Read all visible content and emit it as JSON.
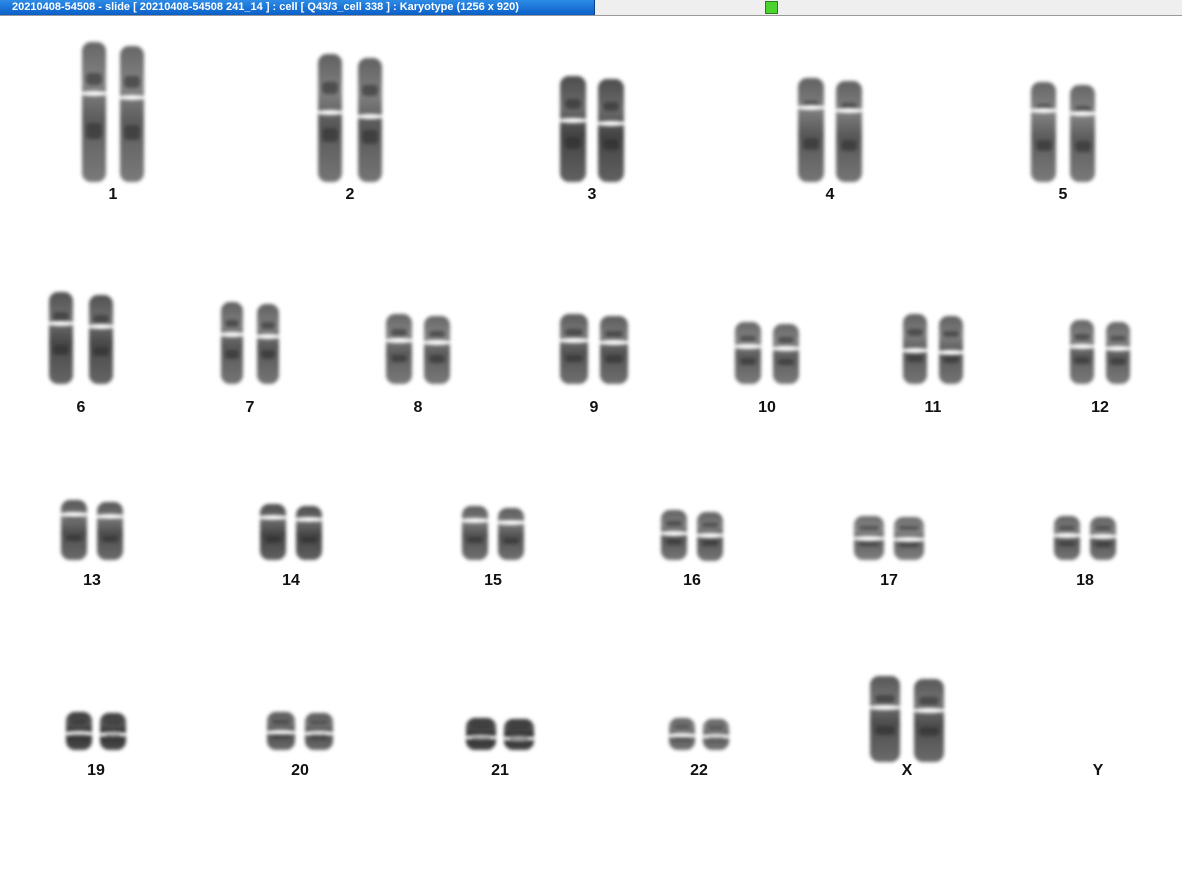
{
  "window": {
    "title": "20210408-54508 - slide [ 20210408-54508 241_14 ] : cell [ Q43/3_cell 338 ] : Karyotype  (1256 x 920)",
    "status_color": "#4cd42e"
  },
  "karyotype": {
    "chromosomes": [
      {
        "label": "1"
      },
      {
        "label": "2"
      },
      {
        "label": "3"
      },
      {
        "label": "4"
      },
      {
        "label": "5"
      },
      {
        "label": "6"
      },
      {
        "label": "7"
      },
      {
        "label": "8"
      },
      {
        "label": "9"
      },
      {
        "label": "10"
      },
      {
        "label": "11"
      },
      {
        "label": "12"
      },
      {
        "label": "13"
      },
      {
        "label": "14"
      },
      {
        "label": "15"
      },
      {
        "label": "16"
      },
      {
        "label": "17"
      },
      {
        "label": "18"
      },
      {
        "label": "19"
      },
      {
        "label": "20"
      },
      {
        "label": "21"
      },
      {
        "label": "22"
      },
      {
        "label": "X"
      },
      {
        "label": "Y"
      }
    ]
  }
}
